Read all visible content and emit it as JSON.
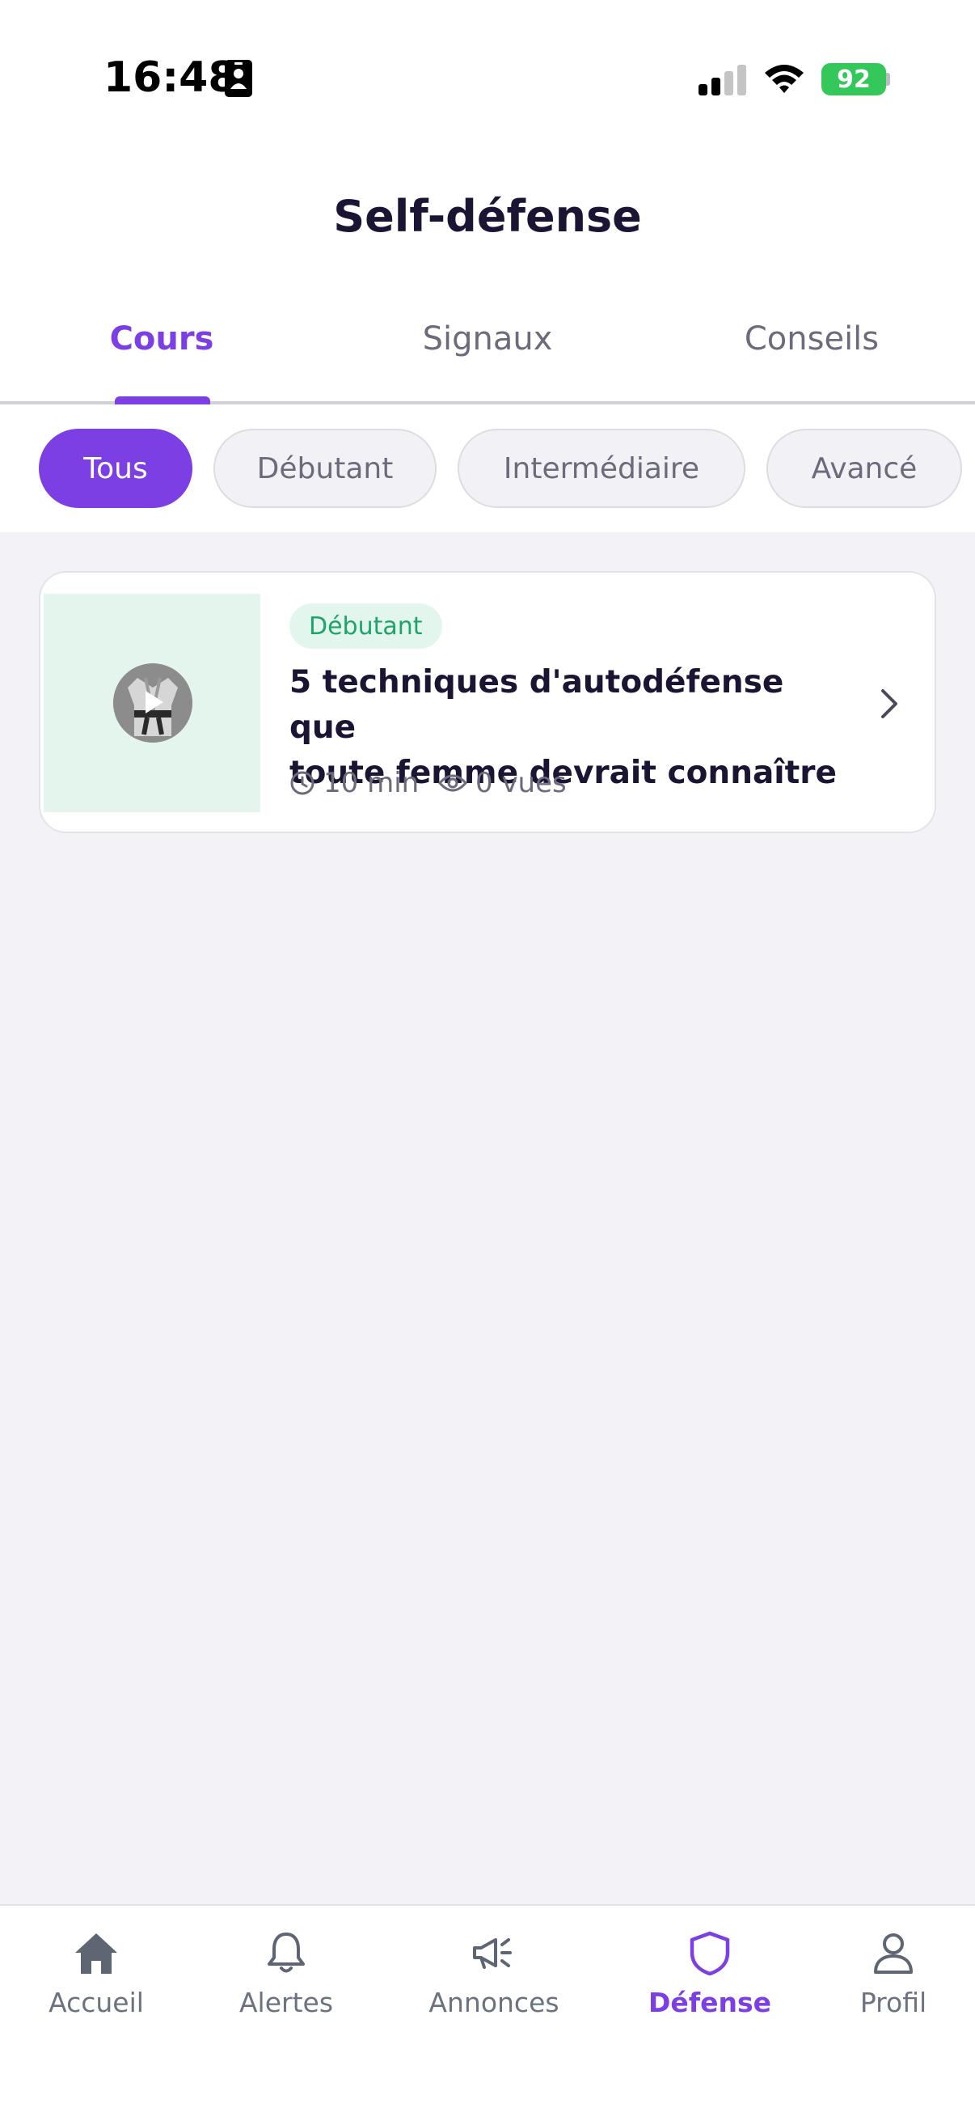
{
  "status_bar": {
    "time": "16:48",
    "battery": "92"
  },
  "header": {
    "title": "Self-défense"
  },
  "tabs": [
    {
      "label": "Cours",
      "active": true
    },
    {
      "label": "Signaux",
      "active": false
    },
    {
      "label": "Conseils",
      "active": false
    }
  ],
  "filters": [
    {
      "label": "Tous",
      "active": true
    },
    {
      "label": "Débutant",
      "active": false
    },
    {
      "label": "Intermédiaire",
      "active": false
    },
    {
      "label": "Avancé",
      "active": false
    }
  ],
  "courses": [
    {
      "level": "Débutant",
      "title_line1": "5 techniques d'autodéfense que",
      "title_line2": "toute femme devrait connaître",
      "duration": "10 min",
      "views": "0 vues"
    }
  ],
  "bottom_nav": [
    {
      "label": "Accueil",
      "icon": "home-icon"
    },
    {
      "label": "Alertes",
      "icon": "bell-icon"
    },
    {
      "label": "Annonces",
      "icon": "megaphone-icon"
    },
    {
      "label": "Défense",
      "icon": "shield-icon",
      "active": true
    },
    {
      "label": "Profil",
      "icon": "user-icon"
    }
  ],
  "colors": {
    "accent": "#7b3fe4",
    "beginner": "#1fa36b",
    "battery": "#34c759"
  }
}
